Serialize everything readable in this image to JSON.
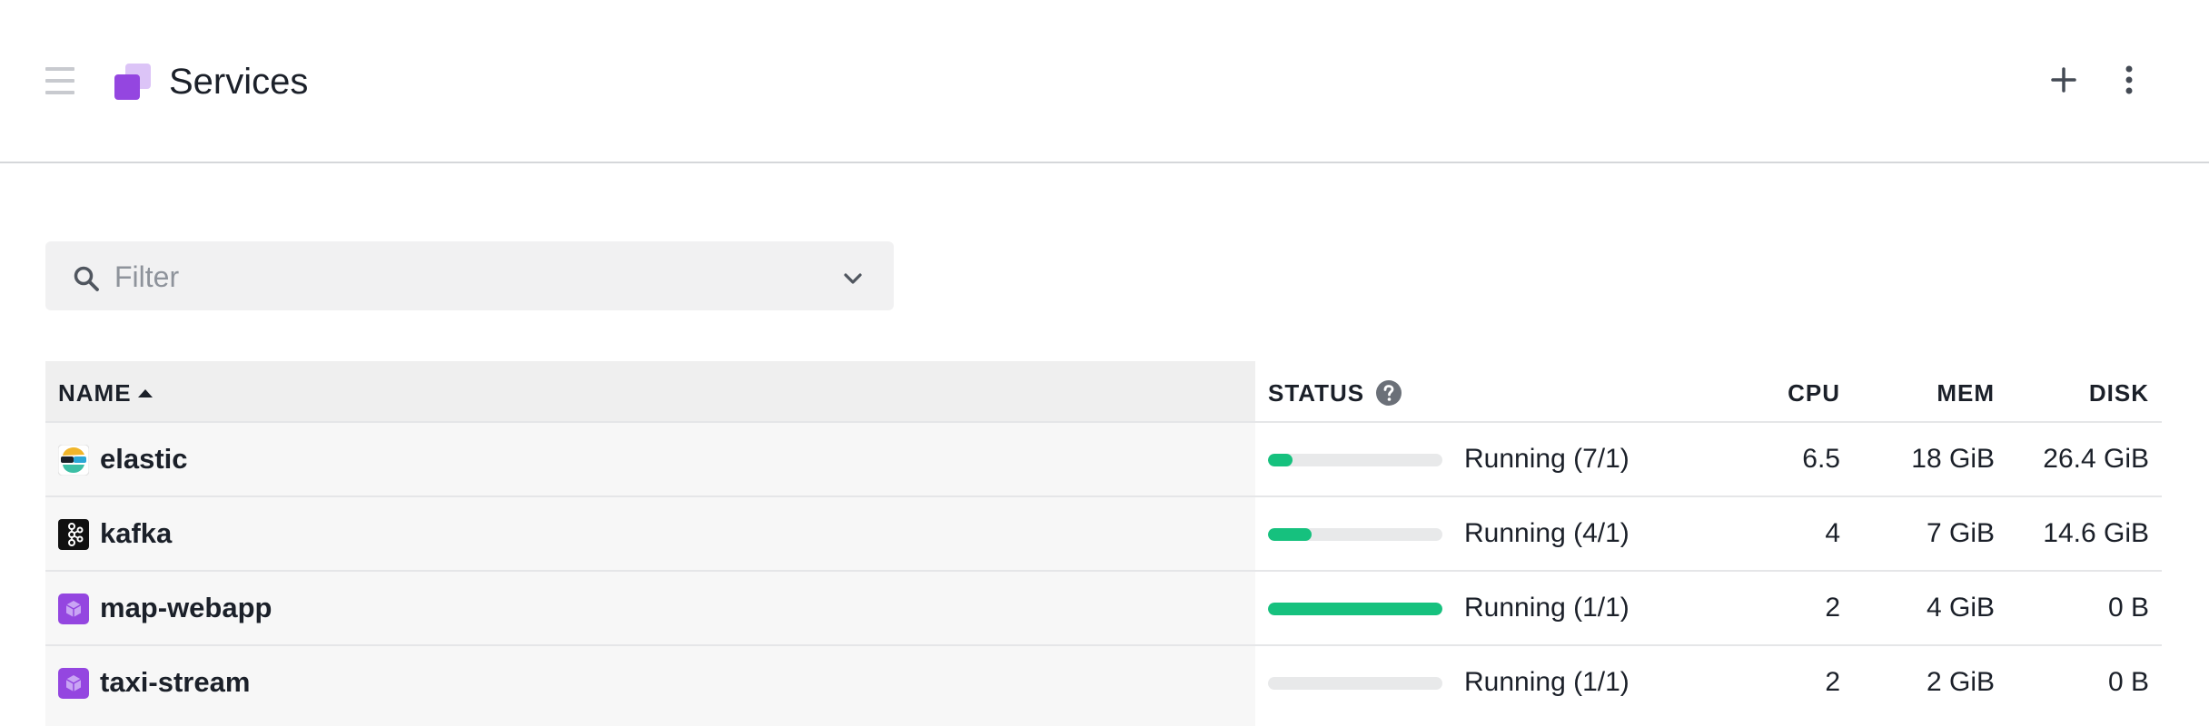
{
  "header": {
    "title": "Services",
    "icons": {
      "menu": "hamburger-icon",
      "logo": "services-logo",
      "add": "plus-icon",
      "more": "more-vertical-icon"
    }
  },
  "filter": {
    "placeholder": "Filter",
    "value": ""
  },
  "table": {
    "columns": {
      "name": "NAME",
      "status": "STATUS",
      "cpu": "CPU",
      "mem": "MEM",
      "disk": "DISK"
    },
    "sort": {
      "column": "name",
      "direction": "ascending"
    },
    "rows": [
      {
        "name": "elastic",
        "icon": "elastic-icon",
        "progress": 0.14,
        "status": "Running (7/1)",
        "cpu": "6.5",
        "mem": "18 GiB",
        "disk": "26.4 GiB"
      },
      {
        "name": "kafka",
        "icon": "kafka-icon",
        "progress": 0.25,
        "status": "Running (4/1)",
        "cpu": "4",
        "mem": "7 GiB",
        "disk": "14.6 GiB"
      },
      {
        "name": "map-webapp",
        "icon": "cube-icon",
        "progress": 1.0,
        "status": "Running (1/1)",
        "cpu": "2",
        "mem": "4 GiB",
        "disk": "0 B"
      },
      {
        "name": "taxi-stream",
        "icon": "cube-icon",
        "progress": 0.0,
        "status": "Running (1/1)",
        "cpu": "2",
        "mem": "2 GiB",
        "disk": "0 B"
      }
    ]
  },
  "colors": {
    "accent": "#9b59e6",
    "progress": "#16c17e",
    "progress_track": "#e8e9ea"
  }
}
